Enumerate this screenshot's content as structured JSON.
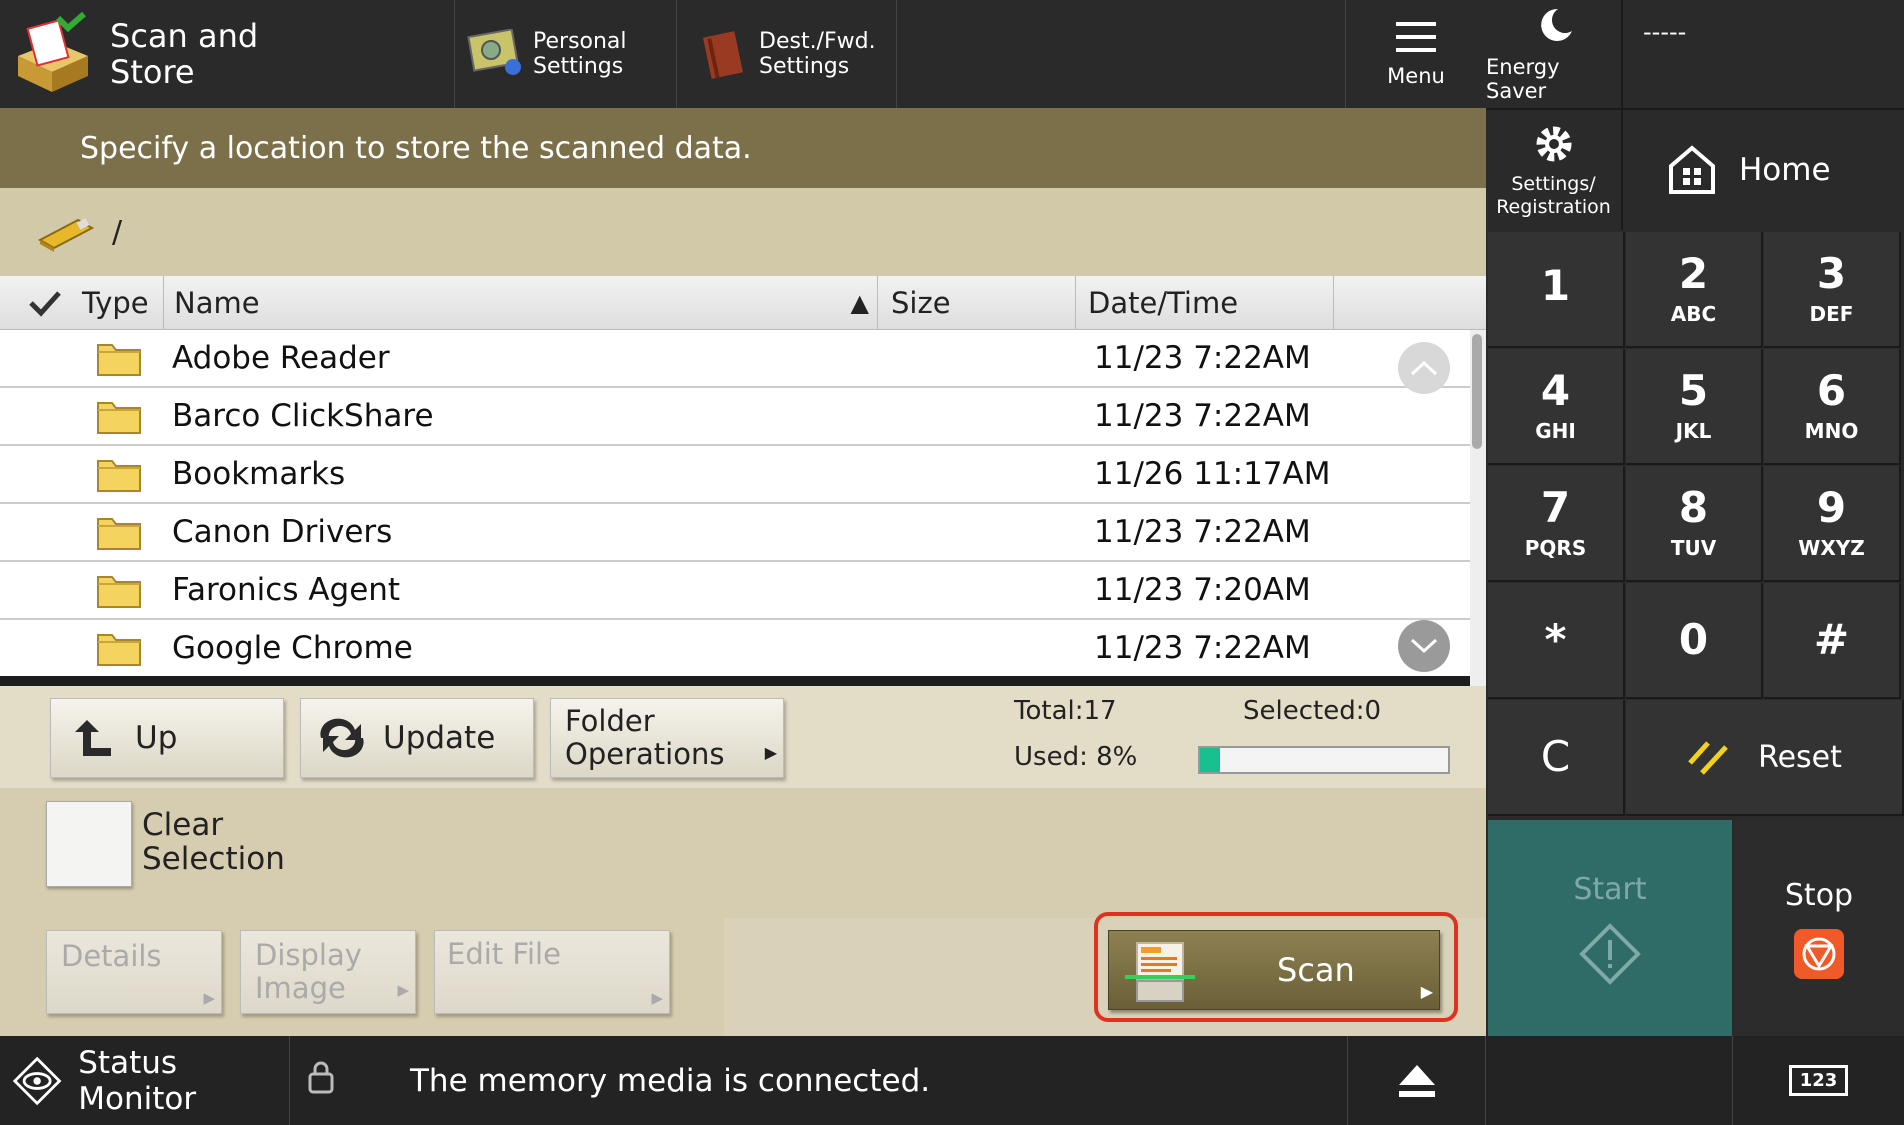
{
  "topbar": {
    "app_title_line1": "Scan and",
    "app_title_line2": "Store",
    "personal_settings_line1": "Personal",
    "personal_settings_line2": "Settings",
    "dest_fwd_line1": "Dest./Fwd.",
    "dest_fwd_line2": "Settings",
    "menu_label": "Menu"
  },
  "message": "Specify a location to store the scanned data.",
  "path": "/",
  "table": {
    "headers": {
      "type": "Type",
      "name": "Name",
      "size": "Size",
      "datetime": "Date/Time"
    },
    "sort_indicator": "▲",
    "rows": [
      {
        "name": "Adobe Reader",
        "size": "",
        "datetime": "11/23 7:22AM"
      },
      {
        "name": "Barco ClickShare",
        "size": "",
        "datetime": "11/23 7:22AM"
      },
      {
        "name": "Bookmarks",
        "size": "",
        "datetime": "11/26 11:17AM"
      },
      {
        "name": "Canon Drivers",
        "size": "",
        "datetime": "11/23 7:22AM"
      },
      {
        "name": "Faronics Agent",
        "size": "",
        "datetime": "11/23 7:20AM"
      },
      {
        "name": "Google Chrome",
        "size": "",
        "datetime": "11/23 7:22AM"
      }
    ]
  },
  "controls": {
    "up_label": "Up",
    "update_label": "Update",
    "folder_ops_line1": "Folder",
    "folder_ops_line2": "Operations",
    "total": "Total:17",
    "selected": "Selected:0",
    "used": "Used: 8%",
    "used_fraction": 0.08
  },
  "lower": {
    "clear_line1": "Clear",
    "clear_line2": "Selection",
    "details_label": "Details",
    "display_image_line1": "Display",
    "display_image_line2": "Image",
    "edit_file_label": "Edit File",
    "scan_label": "Scan"
  },
  "status": {
    "monitor_label": "Status Monitor",
    "message": "The memory media is connected.",
    "keypad_toggle": "123"
  },
  "right": {
    "energy_saver": "Energy Saver",
    "dashes": "-----",
    "settings_line1": "Settings/",
    "settings_line2": "Registration",
    "home": "Home",
    "keys": [
      {
        "n": "1",
        "l": ""
      },
      {
        "n": "2",
        "l": "ABC"
      },
      {
        "n": "3",
        "l": "DEF"
      },
      {
        "n": "4",
        "l": "GHI"
      },
      {
        "n": "5",
        "l": "JKL"
      },
      {
        "n": "6",
        "l": "MNO"
      },
      {
        "n": "7",
        "l": "PQRS"
      },
      {
        "n": "8",
        "l": "TUV"
      },
      {
        "n": "9",
        "l": "WXYZ"
      },
      {
        "n": "*",
        "l": ""
      },
      {
        "n": "0",
        "l": ""
      },
      {
        "n": "#",
        "l": ""
      }
    ],
    "clear_key": "C",
    "reset": "Reset",
    "start": "Start",
    "stop": "Stop"
  },
  "colors": {
    "scan_highlight": "#e03020",
    "start_bg": "#2f6c68",
    "stop_icon": "#f05a28"
  }
}
